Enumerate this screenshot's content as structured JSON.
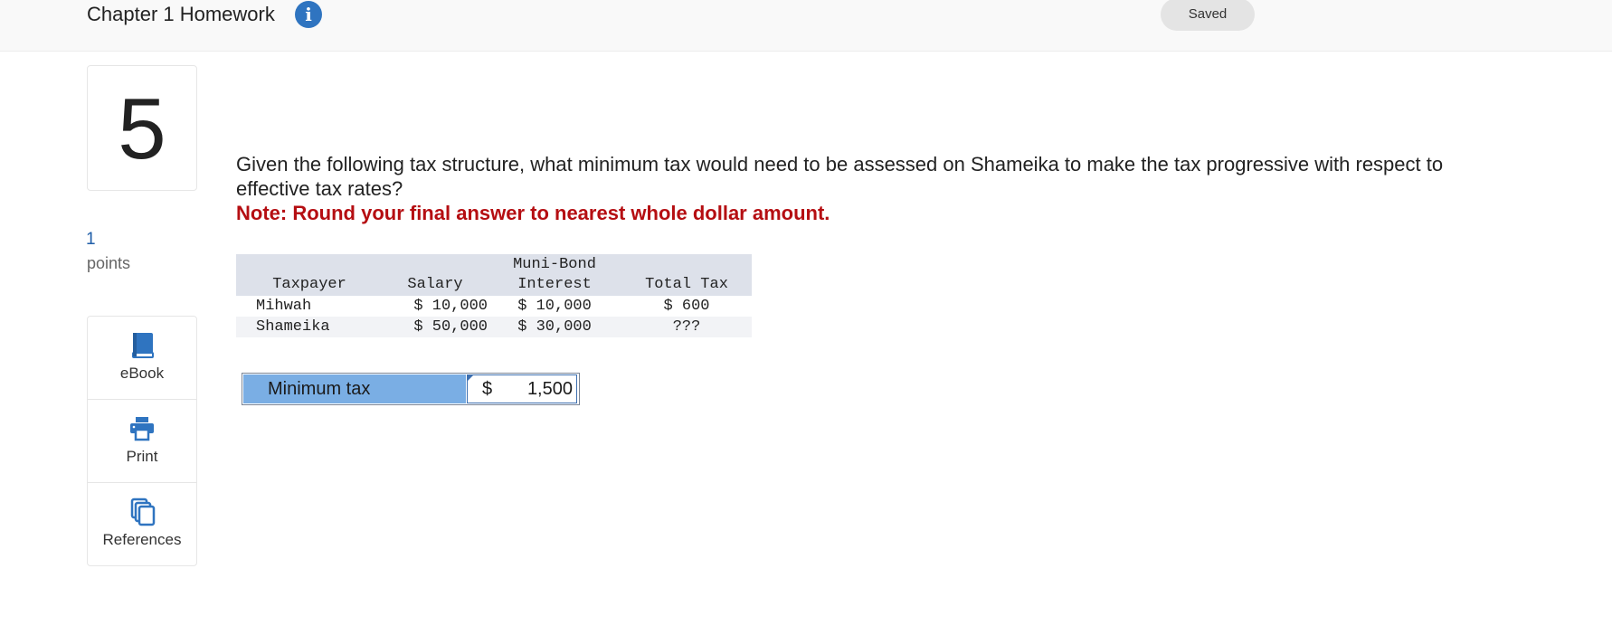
{
  "header": {
    "title": "Chapter 1 Homework",
    "info_icon": "info-icon",
    "saved_label": "Saved"
  },
  "question": {
    "number": "5",
    "points_value": "1",
    "points_label": "points",
    "text": "Given the following tax structure, what minimum tax would need to be assessed on Shameika to make the tax progressive with respect to effective tax rates?",
    "note": "Note: Round your final answer to nearest whole dollar amount."
  },
  "tools": [
    {
      "label": "eBook",
      "icon": "book-icon"
    },
    {
      "label": "Print",
      "icon": "printer-icon"
    },
    {
      "label": "References",
      "icon": "documents-icon"
    }
  ],
  "table": {
    "headers": {
      "taxpayer": "Taxpayer",
      "salary": "Salary",
      "muni_top": "Muni-Bond",
      "muni_bottom": "Interest",
      "total": "Total Tax"
    },
    "rows": [
      {
        "taxpayer": "Mihwah",
        "salary": "$ 10,000",
        "muni": "$ 10,000",
        "total": "$ 600"
      },
      {
        "taxpayer": "Shameika",
        "salary": "$ 50,000",
        "muni": "$ 30,000",
        "total": "???"
      }
    ]
  },
  "answer": {
    "label": "Minimum tax",
    "currency": "$",
    "value": "1,500"
  },
  "colors": {
    "accent_blue": "#2f74c0",
    "note_red": "#b50e12",
    "answer_label_bg": "#7aaee4",
    "table_header_bg": "#dde1ea"
  }
}
